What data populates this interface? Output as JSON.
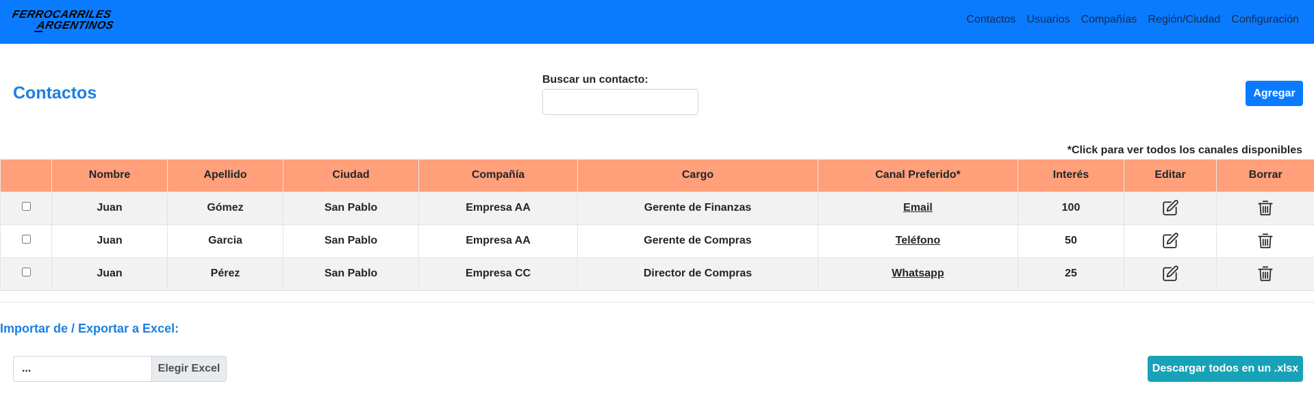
{
  "navbar": {
    "logo_line1": "FERROCARRILES",
    "logo_line2": "ARGENTINOS",
    "links": [
      "Contactos",
      "Usuarios",
      "Compañías",
      "Región/Ciudad",
      "Configuración"
    ]
  },
  "page": {
    "title": "Contactos",
    "search_label": "Buscar un contacto:",
    "search_value": "",
    "add_label": "Agregar",
    "hint": "*Click para ver todos los canales disponibles"
  },
  "table": {
    "headers": [
      "",
      "Nombre",
      "Apellido",
      "Ciudad",
      "Compañía",
      "Cargo",
      "Canal Preferido*",
      "Interés",
      "Editar",
      "Borrar"
    ],
    "rows": [
      {
        "nombre": "Juan",
        "apellido": "Gómez",
        "ciudad": "San Pablo",
        "compania": "Empresa AA",
        "cargo": "Gerente de Finanzas",
        "canal": "Email",
        "interes": "100"
      },
      {
        "nombre": "Juan",
        "apellido": "Garcia",
        "ciudad": "San Pablo",
        "compania": "Empresa AA",
        "cargo": "Gerente de Compras",
        "canal": "Teléfono",
        "interes": "50"
      },
      {
        "nombre": "Juan",
        "apellido": "Pérez",
        "ciudad": "San Pablo",
        "compania": "Empresa CC",
        "cargo": "Director de Compras",
        "canal": "Whatsapp",
        "interes": "25"
      }
    ]
  },
  "excel": {
    "title": "Importar de / Exportar a Excel:",
    "file_placeholder": "...",
    "choose_label": "Elegir Excel",
    "download_label": "Descargar todos en un .xlsx"
  },
  "icons": {
    "edit": "edit-icon",
    "delete": "trash-icon"
  },
  "colors": {
    "navbar": "#0a7bff",
    "table_header": "#ffa07a",
    "title": "#1a7fe0",
    "download_button": "#17a2b8"
  }
}
